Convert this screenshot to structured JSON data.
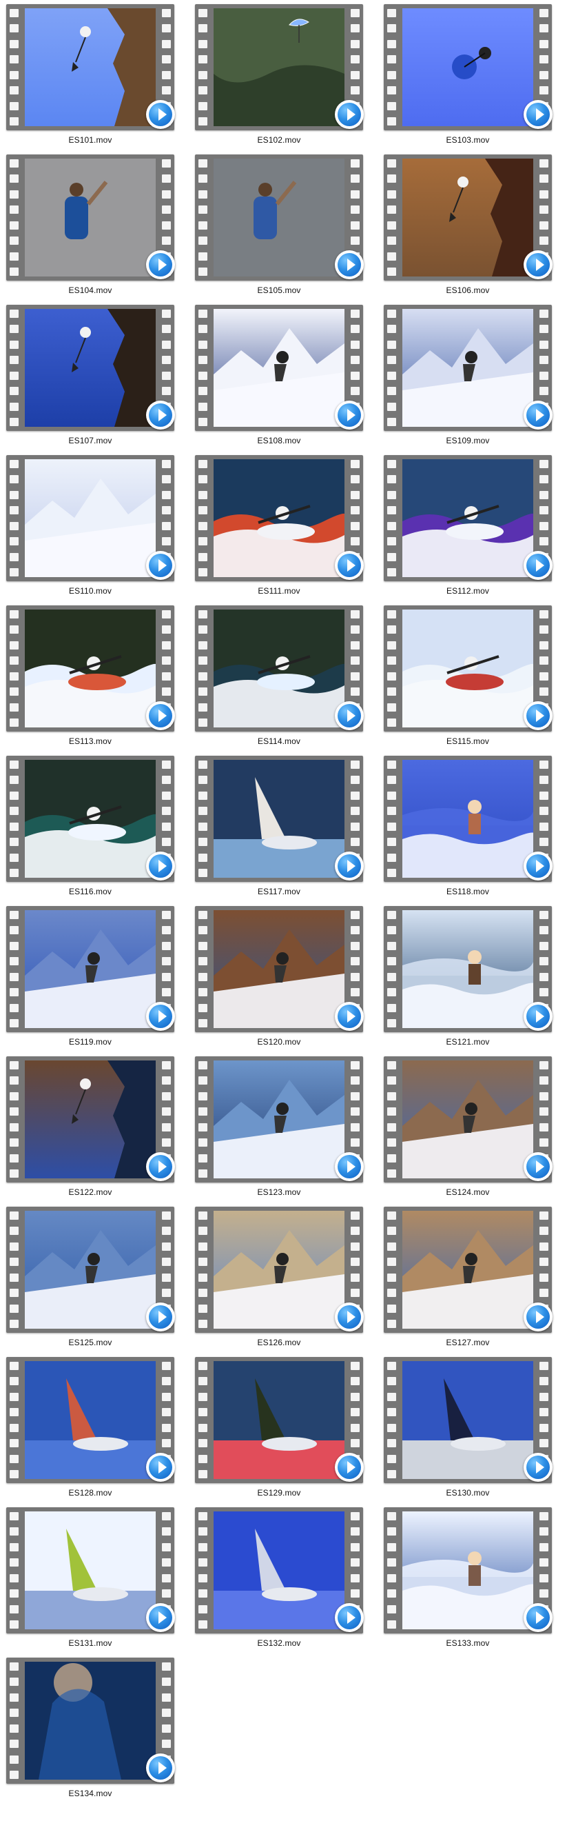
{
  "files": [
    {
      "name": "ES101.mov",
      "scene": "paraglide-cliff",
      "colors": [
        "#5b86f2",
        "#7fa2f7",
        "#6a4a2e"
      ]
    },
    {
      "name": "ES102.mov",
      "scene": "parachute-forest",
      "colors": [
        "#2e3f2a",
        "#495e40",
        "#87b6ff"
      ]
    },
    {
      "name": "ES103.mov",
      "scene": "skydive-blue",
      "colors": [
        "#4e6cf0",
        "#6e8cff",
        "#264cc8"
      ]
    },
    {
      "name": "ES104.mov",
      "scene": "climber-rock",
      "colors": [
        "#8f8f90",
        "#b3b3b6",
        "#1c4f9a"
      ]
    },
    {
      "name": "ES105.mov",
      "scene": "climber-gray",
      "colors": [
        "#6f7478",
        "#959ba0",
        "#2f59a5"
      ]
    },
    {
      "name": "ES106.mov",
      "scene": "climber-brown",
      "colors": [
        "#7a5231",
        "#a66c3a",
        "#452416"
      ]
    },
    {
      "name": "ES107.mov",
      "scene": "cliff-jump",
      "colors": [
        "#1d3fa8",
        "#3d5fd0",
        "#2b2018"
      ]
    },
    {
      "name": "ES108.mov",
      "scene": "snow-ski",
      "colors": [
        "#294087",
        "#f2f4fb",
        "#c8d3ef"
      ]
    },
    {
      "name": "ES109.mov",
      "scene": "ski-jump-mountain",
      "colors": [
        "#3e5da6",
        "#d7def2",
        "#24305d"
      ]
    },
    {
      "name": "ES110.mov",
      "scene": "snowy-peak",
      "colors": [
        "#bcc8ea",
        "#edf2fb",
        "#6a7db2"
      ]
    },
    {
      "name": "ES111.mov",
      "scene": "kayak-red",
      "colors": [
        "#1b3a5d",
        "#d2492d",
        "#f2f3f7"
      ]
    },
    {
      "name": "ES112.mov",
      "scene": "kayak-purple",
      "colors": [
        "#264878",
        "#5a31b0",
        "#f2f5fb"
      ]
    },
    {
      "name": "ES113.mov",
      "scene": "waterfall-kayak",
      "colors": [
        "#243020",
        "#e8f1ff",
        "#d95739"
      ]
    },
    {
      "name": "ES114.mov",
      "scene": "river-kayak",
      "colors": [
        "#243428",
        "#1d3b4a",
        "#e5f1ff"
      ]
    },
    {
      "name": "ES115.mov",
      "scene": "kayak-helmet",
      "colors": [
        "#d5e1f5",
        "#eef4fb",
        "#c53c35"
      ]
    },
    {
      "name": "ES116.mov",
      "scene": "rapids",
      "colors": [
        "#20312a",
        "#1d5a55",
        "#f0f6ff"
      ]
    },
    {
      "name": "ES117.mov",
      "scene": "wakeboard-spray",
      "colors": [
        "#223b61",
        "#7aa4d0",
        "#f4efe8"
      ]
    },
    {
      "name": "ES118.mov",
      "scene": "wake-air",
      "colors": [
        "#2b48c0",
        "#4c6ae0",
        "#b26a4a"
      ]
    },
    {
      "name": "ES119.mov",
      "scene": "waterski-shore",
      "colors": [
        "#2c53b6",
        "#6b88ca",
        "#10213c"
      ]
    },
    {
      "name": "ES120.mov",
      "scene": "waterski-mountain",
      "colors": [
        "#31558f",
        "#7d4f32",
        "#101b30"
      ]
    },
    {
      "name": "ES121.mov",
      "scene": "wake-splash",
      "colors": [
        "#2a4f7a",
        "#d6e2f2",
        "#61422d"
      ]
    },
    {
      "name": "ES122.mov",
      "scene": "waterski-cliff",
      "colors": [
        "#2d4ea7",
        "#6a4730",
        "#152543"
      ]
    },
    {
      "name": "ES123.mov",
      "scene": "waterski-blue",
      "colors": [
        "#203c74",
        "#6d95ca",
        "#eef4ff"
      ]
    },
    {
      "name": "ES124.mov",
      "scene": "skier-standing",
      "colors": [
        "#3d69b8",
        "#8c6a4f",
        "#e8eef8"
      ]
    },
    {
      "name": "ES125.mov",
      "scene": "waterski-wide",
      "colors": [
        "#2e5aa8",
        "#6589c4",
        "#0f2445"
      ]
    },
    {
      "name": "ES126.mov",
      "scene": "waterski-lake",
      "colors": [
        "#5f86c8",
        "#c4b08d",
        "#19345f"
      ]
    },
    {
      "name": "ES127.mov",
      "scene": "waterski-bank",
      "colors": [
        "#3c67b0",
        "#b08a63",
        "#f1f5fb"
      ]
    },
    {
      "name": "ES128.mov",
      "scene": "windsurf-air",
      "colors": [
        "#2b56b7",
        "#4b76d7",
        "#d45b3a"
      ]
    },
    {
      "name": "ES129.mov",
      "scene": "windsurf-red",
      "colors": [
        "#25436f",
        "#e14d5a",
        "#273319"
      ]
    },
    {
      "name": "ES130.mov",
      "scene": "windsurf-board",
      "colors": [
        "#3155c0",
        "#cfd4dd",
        "#171d39"
      ]
    },
    {
      "name": "ES131.mov",
      "scene": "windsurf-splash",
      "colors": [
        "#eef4ff",
        "#8fa7d8",
        "#9cbf2f"
      ]
    },
    {
      "name": "ES132.mov",
      "scene": "windsurf-jump",
      "colors": [
        "#2b4bd0",
        "#5a76e8",
        "#d9dde8"
      ]
    },
    {
      "name": "ES133.mov",
      "scene": "surf-wipeout",
      "colors": [
        "#3259a8",
        "#edf3ff",
        "#7b5a49"
      ]
    },
    {
      "name": "ES134.mov",
      "scene": "underwater-closeup",
      "colors": [
        "#12305f",
        "#245cad",
        "#b8a087"
      ]
    }
  ]
}
